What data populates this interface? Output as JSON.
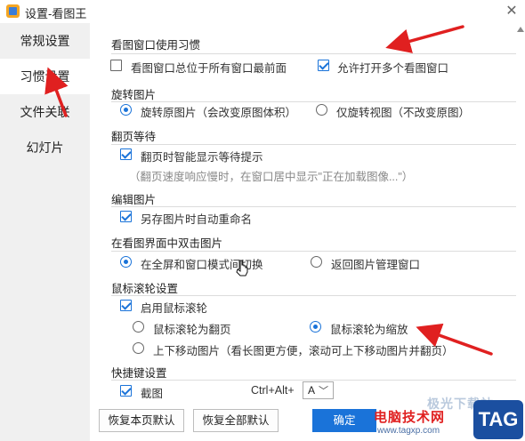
{
  "window": {
    "title": "设置-看图王",
    "close_symbol": "✕"
  },
  "sidebar": {
    "items": [
      {
        "label": "常规设置",
        "active": false
      },
      {
        "label": "习惯设置",
        "active": true
      },
      {
        "label": "文件关联",
        "active": false
      },
      {
        "label": "幻灯片",
        "active": false
      }
    ]
  },
  "sections": {
    "window_habit": {
      "title": "看图窗口使用习惯",
      "opt_topmost": {
        "label": "看图窗口总位于所有窗口最前面",
        "checked": false
      },
      "opt_multi": {
        "label": "允许打开多个看图窗口",
        "checked": true
      }
    },
    "rotate": {
      "title": "旋转图片",
      "opt_rotate_original": {
        "label": "旋转原图片（会改变原图体积）",
        "checked": true
      },
      "opt_rotate_view": {
        "label": "仅旋转视图（不改变原图）",
        "checked": false
      }
    },
    "page_wait": {
      "title": "翻页等待",
      "opt_smart_wait": {
        "label": "翻页时智能显示等待提示",
        "checked": true
      },
      "hint": "（翻页速度响应慢时，在窗口居中显示\"正在加载图像...\"）"
    },
    "edit": {
      "title": "编辑图片",
      "opt_autorename": {
        "label": "另存图片时自动重命名",
        "checked": true
      }
    },
    "double_click": {
      "title": "在看图界面中双击图片",
      "opt_toggle_full": {
        "label": "在全屏和窗口模式间切换",
        "checked": true
      },
      "opt_back_manager": {
        "label": "返回图片管理窗口",
        "checked": false
      }
    },
    "wheel": {
      "title": "鼠标滚轮设置",
      "opt_enable": {
        "label": "启用鼠标滚轮",
        "checked": true
      },
      "opt_page": {
        "label": "鼠标滚轮为翻页",
        "checked": false
      },
      "opt_zoom": {
        "label": "鼠标滚轮为缩放",
        "checked": true
      },
      "opt_move": {
        "label": "上下移动图片（看长图更方便，滚动可上下移动图片并翻页）",
        "checked": false
      }
    },
    "hotkey": {
      "title": "快捷键设置",
      "opt_screenshot": {
        "label": "截图",
        "checked": true
      },
      "combo_prefix": "Ctrl+Alt+",
      "combo_key": "A",
      "chevron": "﹀"
    }
  },
  "footer": {
    "restore_page": "恢复本页默认",
    "restore_all": "恢复全部默认",
    "ok": "确定"
  },
  "watermark": {
    "faint_text": "极光下载站",
    "site_name": "电脑技术网",
    "url": "www.tagxp.com",
    "tag": "TAG"
  },
  "colors": {
    "accent": "#1a73d9",
    "annotation_arrow": "#e02020",
    "sidebar_bg": "#f0f0f0"
  }
}
